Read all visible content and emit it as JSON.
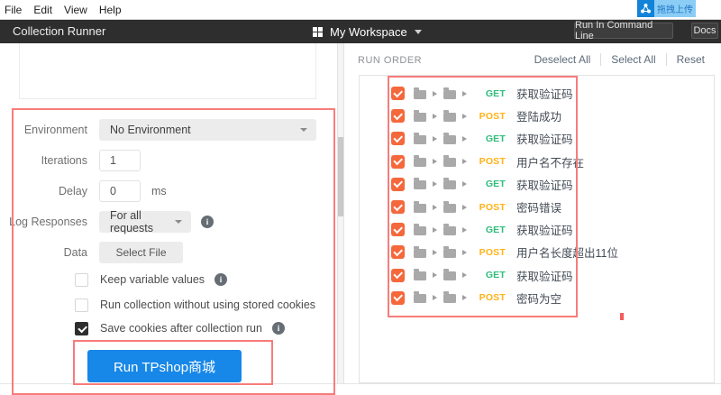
{
  "menu": {
    "items": [
      "File",
      "Edit",
      "View",
      "Help"
    ]
  },
  "overlay_badge": {
    "label": "拖拽上传"
  },
  "header": {
    "title": "Collection Runner",
    "workspace": "My Workspace",
    "run_in_command_line": "Run In Command Line",
    "docs": "Docs"
  },
  "form": {
    "environment": {
      "label": "Environment",
      "value": "No Environment"
    },
    "iterations": {
      "label": "Iterations",
      "value": "1"
    },
    "delay": {
      "label": "Delay",
      "value": "0",
      "unit": "ms"
    },
    "log_responses": {
      "label": "Log Responses",
      "value": "For all requests"
    },
    "data": {
      "label": "Data",
      "button": "Select File"
    },
    "checkboxes": [
      {
        "label": "Keep variable values",
        "checked": false,
        "info": true
      },
      {
        "label": "Run collection without using stored cookies",
        "checked": false,
        "info": false
      },
      {
        "label": "Save cookies after collection run",
        "checked": true,
        "info": true
      }
    ],
    "run_button": "Run TPshop商城"
  },
  "run_order": {
    "title": "RUN ORDER",
    "actions": [
      "Deselect All",
      "Select All",
      "Reset"
    ],
    "items": [
      {
        "method": "GET",
        "name": "获取验证码",
        "checked": true
      },
      {
        "method": "POST",
        "name": "登陆成功",
        "checked": true
      },
      {
        "method": "GET",
        "name": "获取验证码",
        "checked": true
      },
      {
        "method": "POST",
        "name": "用户名不存在",
        "checked": true
      },
      {
        "method": "GET",
        "name": "获取验证码",
        "checked": true
      },
      {
        "method": "POST",
        "name": "密码错误",
        "checked": true
      },
      {
        "method": "GET",
        "name": "获取验证码",
        "checked": true
      },
      {
        "method": "POST",
        "name": "用户名长度超出11位",
        "checked": true
      },
      {
        "method": "GET",
        "name": "获取验证码",
        "checked": true
      },
      {
        "method": "POST",
        "name": "密码为空",
        "checked": true
      }
    ]
  },
  "colors": {
    "accent_blue": "#1787e8",
    "checkbox_orange": "#f4683c",
    "get_green": "#2ebd7b",
    "post_orange": "#ffb216",
    "annotation_red": "#f87b7b",
    "header_dark": "#2e2e2e"
  }
}
